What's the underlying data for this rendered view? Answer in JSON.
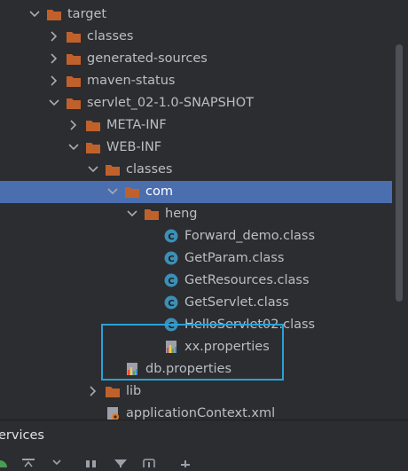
{
  "tree": {
    "items": [
      {
        "label": "target",
        "kind": "folder",
        "expanded": true,
        "depth": 0
      },
      {
        "label": "classes",
        "kind": "folder",
        "expanded": false,
        "depth": 1
      },
      {
        "label": "generated-sources",
        "kind": "folder",
        "expanded": false,
        "depth": 1
      },
      {
        "label": "maven-status",
        "kind": "folder",
        "expanded": false,
        "depth": 1
      },
      {
        "label": "servlet_02-1.0-SNAPSHOT",
        "kind": "folder",
        "expanded": true,
        "depth": 1
      },
      {
        "label": "META-INF",
        "kind": "folder",
        "expanded": false,
        "depth": 2
      },
      {
        "label": "WEB-INF",
        "kind": "folder",
        "expanded": true,
        "depth": 2
      },
      {
        "label": "classes",
        "kind": "folder",
        "expanded": true,
        "depth": 3
      },
      {
        "label": "com",
        "kind": "folder",
        "expanded": true,
        "depth": 4,
        "selected": true
      },
      {
        "label": "heng",
        "kind": "folder",
        "expanded": true,
        "depth": 5
      },
      {
        "label": "Forward_demo.class",
        "kind": "class",
        "depth": 6
      },
      {
        "label": "GetParam.class",
        "kind": "class",
        "depth": 6
      },
      {
        "label": "GetResources.class",
        "kind": "class",
        "depth": 6
      },
      {
        "label": "GetServlet.class",
        "kind": "class",
        "depth": 6
      },
      {
        "label": "HelloServlet02.class",
        "kind": "class",
        "depth": 6
      },
      {
        "label": "xx.properties",
        "kind": "properties",
        "depth": 6
      },
      {
        "label": "db.properties",
        "kind": "properties",
        "depth": 4
      },
      {
        "label": "lib",
        "kind": "folder",
        "expanded": false,
        "depth": 3
      },
      {
        "label": "applicationContext.xml",
        "kind": "xml",
        "depth": 3
      }
    ]
  },
  "services": {
    "title": "ervices"
  },
  "colors": {
    "background": "#2b2d30",
    "selection": "#4b6eaf",
    "folder": "#c0612c",
    "class_icon": "#3d8fb5",
    "highlight_box": "#2aa1d8",
    "text": "#bcbec4"
  },
  "icons": {
    "folder": "folder-icon",
    "class": "java-class-icon",
    "properties": "properties-file-icon",
    "xml": "xml-file-icon",
    "chevron_open": "chevron-down-icon",
    "chevron_closed": "chevron-right-icon"
  }
}
